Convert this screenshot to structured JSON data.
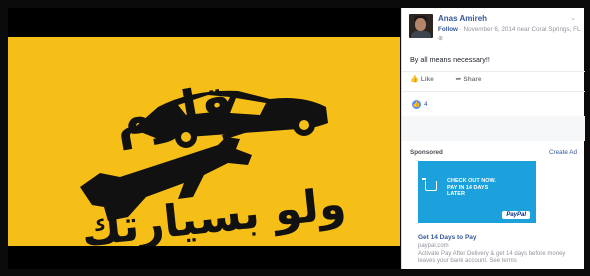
{
  "post": {
    "author": "Anas Amireh",
    "follow": "Follow",
    "date_location": "November 6, 2014 near Coral Springs, FL",
    "privacy_icon": "globe-icon",
    "status": "By all means necessary!!",
    "like_label": "Like",
    "share_label": "Share",
    "reaction_count": "4"
  },
  "photo": {
    "arabic_line1": "قاوم",
    "arabic_line2": "ولو بسيارتك",
    "background_color": "#f6bf18"
  },
  "ad": {
    "sponsored_label": "Sponsored",
    "create_ad_label": "Create Ad",
    "image_headline": "CHECK OUT NOW. PAY IN 14 DAYS LATER",
    "image_brand": "PayPal",
    "title": "Get 14 Days to Pay",
    "domain": "paypal.com",
    "description": "Activate Pay After Delivery & get 14 days before money leaves your bank account. See terms"
  }
}
